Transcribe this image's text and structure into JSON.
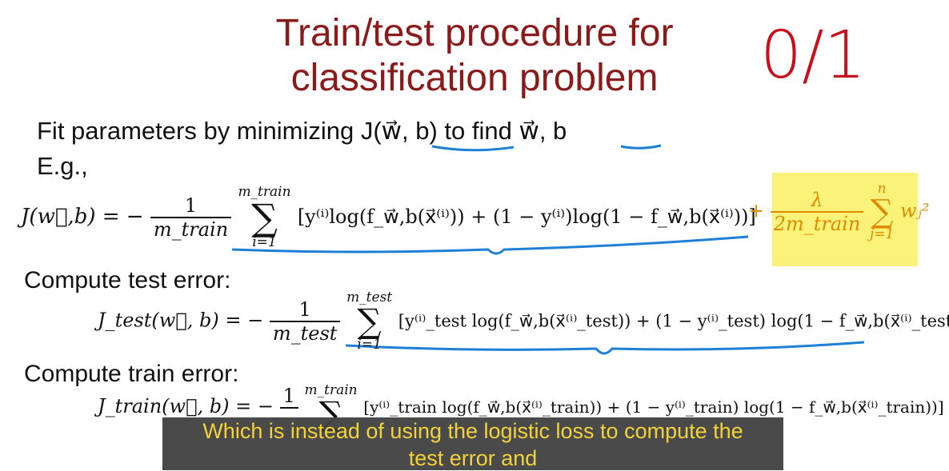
{
  "slide": {
    "title_line1": "Train/test procedure for",
    "title_line2": "classification problem",
    "handwritten_note": "0/1",
    "fit_text": "Fit parameters by minimizing J(w⃗, b) to find w⃗, b",
    "eg_label": "E.g.,",
    "cost_lhs": "J(w⃗,b) = −",
    "cost_num": "1",
    "cost_den": "m_train",
    "cost_sum_top": "m_train",
    "cost_sum_bot": "i=1",
    "cost_body": "[y⁽ⁱ⁾log(f_w⃗,b(x⃗⁽ⁱ⁾)) + (1 − y⁽ⁱ⁾)log(1 − f_w⃗,b(x⃗⁽ⁱ⁾))]",
    "reg_plus": "+",
    "reg_num": "λ",
    "reg_den": "2m_train",
    "reg_sum_top": "n",
    "reg_sum_bot": "j=1",
    "reg_term": "wⱼ²",
    "test_heading": "Compute test error:",
    "test_lhs": "J_test(w⃗, b) = −",
    "test_num": "1",
    "test_den": "m_test",
    "test_sum_top": "m_test",
    "test_sum_bot": "i=1",
    "test_body": "[y⁽ⁱ⁾_test log(f_w⃗,b(x⃗⁽ⁱ⁾_test)) + (1 − y⁽ⁱ⁾_test) log(1 − f_w⃗,b(x⃗⁽ⁱ⁾_test))]",
    "train_heading": "Compute train error:",
    "train_lhs": "J_train(w⃗, b) = −",
    "train_num": "1",
    "train_sum_top": "m_train",
    "train_body": "[y⁽ⁱ⁾_train log(f_w⃗,b(x⃗⁽ⁱ⁾_train)) + (1 − y⁽ⁱ⁾_train) log(1 − f_w⃗,b(x⃗⁽ⁱ⁾_train))]"
  },
  "subtitle": {
    "line1": "Which is instead of using the logistic loss to compute the",
    "line2": "test error and"
  },
  "colors": {
    "title": "#8b1a1a",
    "handwritten": "#c8101c",
    "annotation": "#1e7fd6",
    "highlight": "#fbf27a",
    "regularization": "#e08a00",
    "subtitle_text": "#f4d23a"
  }
}
